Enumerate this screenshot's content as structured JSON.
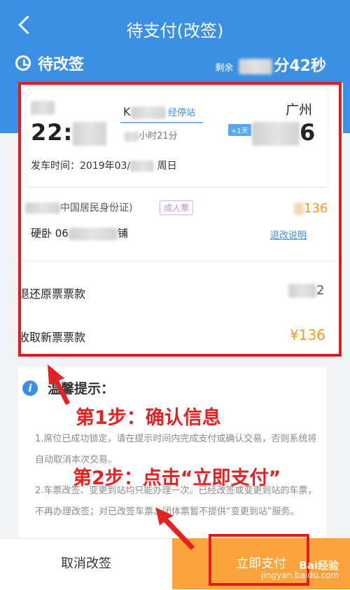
{
  "header": {
    "title": "待支付(改签)",
    "status_title": "待改签",
    "remaining_label": "剩余",
    "remaining_value": "分42秒"
  },
  "ticket": {
    "from_station": "",
    "to_station": "广州",
    "departure_time": "22:",
    "train_number": "K",
    "via_stops": "经停站",
    "duration": "小时21分",
    "plus_day": "+1天",
    "departure_date_label": "发车时间：2019年03/",
    "departure_weekday": "周日",
    "passenger_id_type": "中国居民身份证)",
    "ticket_type": "成人票",
    "price": "136",
    "seat": "硬卧 06",
    "seat_berth": "铺",
    "rules_link": "退改说明"
  },
  "summary": {
    "refund_label": "退还原票票款",
    "refund_value": "2",
    "collect_label": "收取新票票款",
    "collect_value": "¥136"
  },
  "tips": {
    "title": "温馨提示：",
    "item1": "1.席位已成功锁定，请在提示时间内完成支付或确认交易，否则系统将自动取消本次交易。",
    "item2": "2.车票改签、变更到站均只能办理一次。已经改签或变更到站的车票，不再办理改签；对已改签车票、团体票暂不提供“变更到站”服务。"
  },
  "annotations": {
    "step1": "第1步：确认信息",
    "step2": "第2步：点击“立即支付”"
  },
  "buttons": {
    "cancel": "取消改签",
    "pay": "立即支付"
  },
  "watermark": {
    "brand": "Bai经验",
    "url": "jingyan.baidu.com"
  },
  "colors": {
    "primary": "#3b8fe4",
    "accent": "#fca33d",
    "annotation": "#e21c1c"
  }
}
